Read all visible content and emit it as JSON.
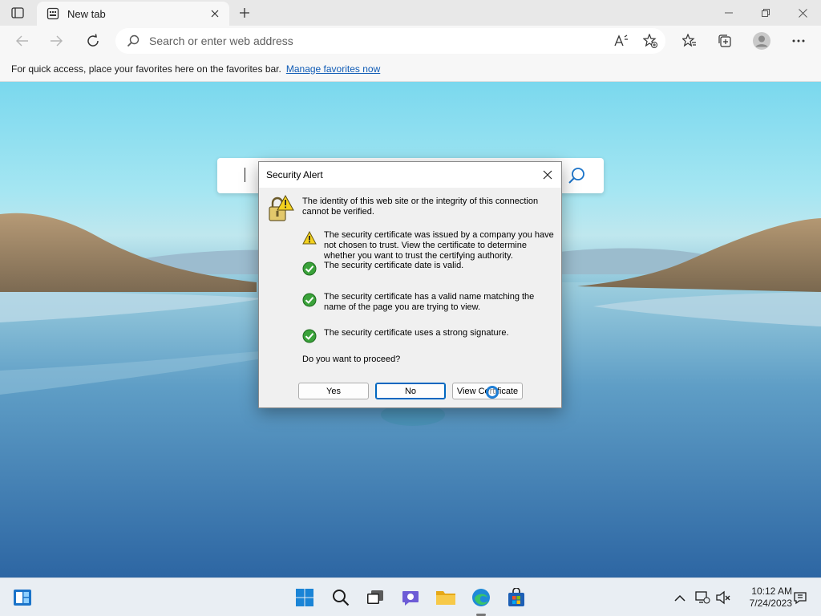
{
  "browser": {
    "tab": {
      "title": "New tab"
    },
    "address_bar": {
      "placeholder": "Search or enter web address",
      "value": ""
    },
    "favorites_bar": {
      "message": "For quick access, place your favorites here on the favorites bar.",
      "link": "Manage favorites now"
    }
  },
  "dialog": {
    "title": "Security Alert",
    "intro": "The identity of this web site or the integrity of this connection cannot be verified.",
    "items": [
      {
        "status": "warning",
        "icon": "warning-icon",
        "text": "The security certificate was issued by a company you have not chosen to trust. View the certificate to determine whether you want to trust the certifying authority."
      },
      {
        "status": "ok",
        "icon": "check-icon",
        "text": "The security certificate date is valid."
      },
      {
        "status": "ok",
        "icon": "check-icon",
        "text": "The security certificate has a valid name matching the name of the page you are trying to view."
      },
      {
        "status": "ok",
        "icon": "check-icon",
        "text": "The security certificate uses a strong signature."
      }
    ],
    "question": "Do you want to proceed?",
    "buttons": {
      "yes": "Yes",
      "no": "No",
      "view": "View Certificate"
    }
  },
  "taskbar": {
    "clock": {
      "time": "10:12 AM",
      "date": "7/24/2023"
    }
  },
  "colors": {
    "accent": "#0067c0",
    "link": "#0f5bb5",
    "warning": "#f4d21e",
    "ok": "#3aa23a"
  }
}
